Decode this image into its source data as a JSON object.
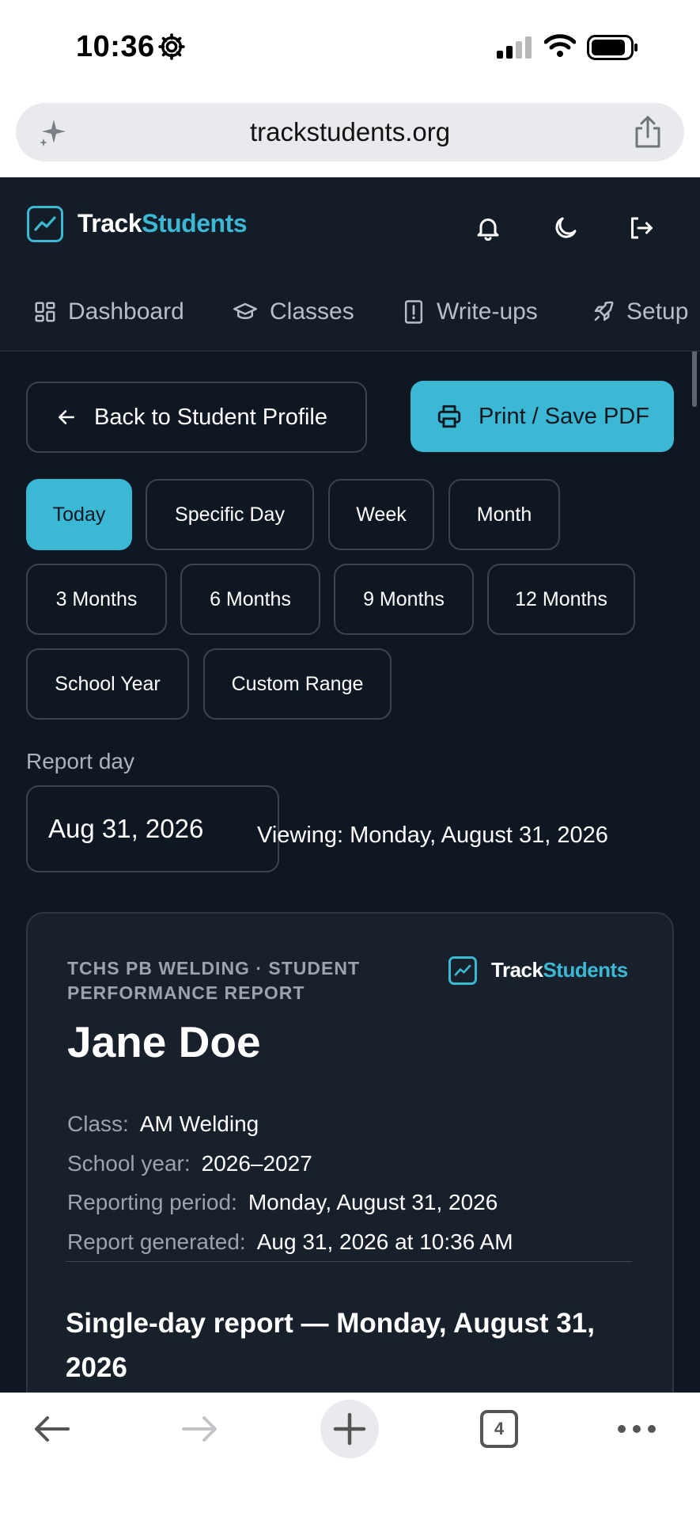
{
  "status_bar": {
    "time": "10:36"
  },
  "browser": {
    "url": "trackstudents.org",
    "tab_count": "4"
  },
  "brand": {
    "part1": "Track",
    "part2": "Students",
    "accent": "#3bb8d3"
  },
  "nav": {
    "items": [
      {
        "label": "Dashboard",
        "icon": "dashboard-icon"
      },
      {
        "label": "Classes",
        "icon": "graduation-cap-icon"
      },
      {
        "label": "Write-ups",
        "icon": "alert-file-icon"
      },
      {
        "label": "Setup",
        "icon": "rocket-icon"
      }
    ]
  },
  "actions": {
    "back_label": "Back to Student Profile",
    "print_label": "Print / Save PDF"
  },
  "ranges": {
    "active": "Today",
    "options": [
      "Today",
      "Specific Day",
      "Week",
      "Month",
      "3 Months",
      "6 Months",
      "9 Months",
      "12 Months",
      "School Year",
      "Custom Range"
    ]
  },
  "report_day": {
    "label": "Report day",
    "value": "Aug 31, 2026",
    "viewing": "Viewing: Monday, August 31, 2026"
  },
  "report": {
    "subtitle": "TCHS PB WELDING · STUDENT PERFORMANCE REPORT",
    "student_name": "Jane Doe",
    "meta": [
      {
        "key": "Class:",
        "value": "AM Welding"
      },
      {
        "key": "School year:",
        "value": "2026–2027"
      },
      {
        "key": "Reporting period:",
        "value": "Monday, August 31, 2026"
      },
      {
        "key": "Report generated:",
        "value": "Aug 31, 2026 at 10:36 AM"
      }
    ],
    "section_title": "Single-day report — Monday, August 31, 2026"
  }
}
